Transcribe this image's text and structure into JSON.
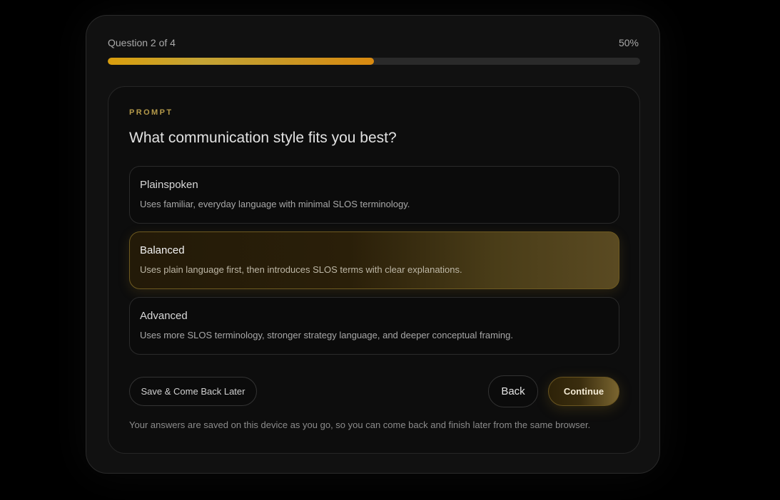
{
  "progress": {
    "step_text": "Question 2 of 4",
    "percent_text": "50%",
    "fraction": 0.5
  },
  "section_label": "PROMPT",
  "question": "What communication style fits you best?",
  "options": [
    {
      "title": "Plainspoken",
      "description": "Uses familiar, everyday language with minimal SLOS terminology.",
      "selected": false
    },
    {
      "title": "Balanced",
      "description": "Uses plain language first, then introduces SLOS terms with clear explanations.",
      "selected": true
    },
    {
      "title": "Advanced",
      "description": "Uses more SLOS terminology, stronger strategy language, and deeper conceptual framing.",
      "selected": false
    }
  ],
  "buttons": {
    "save_label": "Save & Come Back Later",
    "back_label": "Back",
    "continue_label": "Continue"
  },
  "footnote": "Your answers are saved on this device as you go, so you can come back and finish later from the same browser.",
  "colors": {
    "accent": "#d99e0d",
    "background": "#000000",
    "card": "#111111"
  }
}
